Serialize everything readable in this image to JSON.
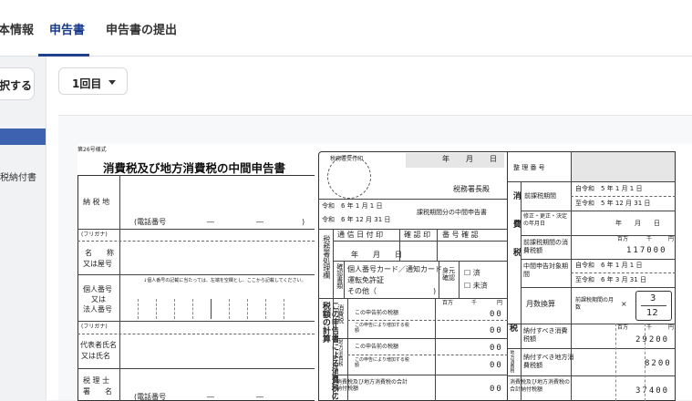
{
  "tabs": [
    {
      "label": "本情報"
    },
    {
      "label": "申告書"
    },
    {
      "label": "申告書の提出"
    }
  ],
  "sidebar": {
    "action_label": "択する",
    "item_label": "税納付書"
  },
  "period_select": {
    "value": "1回目"
  },
  "form": {
    "form_number": "第26号様式",
    "title": "消費税及び地方消費税の中間申告書",
    "stamp_label": "税務署受付印",
    "date_year": "年",
    "date_month": "月",
    "date_day": "日",
    "tax_office_suffix": "税務署長殿",
    "seiri_label": "整 理 番 号",
    "nozeichi_label": "納 税 地",
    "phone_label": "(電話番号",
    "dash": "―",
    "paren_close": ")",
    "furigana": "(フリガナ)",
    "name_label": [
      "名　　称",
      "又は屋号"
    ],
    "mynumber_note": "↓個人番号の記載に当たっては、左端を空欄とし、ここから記載してください。",
    "mynumber_label": [
      "個人番号",
      "又は",
      "法人番号"
    ],
    "rep_label": [
      "代表者氏名",
      "又は氏名"
    ],
    "zeirishi_label": [
      "税 理 士",
      "署　　名"
    ],
    "period_from": "令和　6 年 1 月 1 日",
    "period_to": "令和　6 年 12 月 31 日",
    "period_caption": "課税期間分の中間申告書",
    "shori_label": "税務署処理欄",
    "tsushin_label": "通 信 日 付 印",
    "kakunin_label": "確 認 印",
    "bango_label": "番 号 確 認",
    "date_cell": "年　　月　　日",
    "kakunin_shorui": "確認書類",
    "id_docs": [
      "個人番号カード／通知カード",
      "運転免許証",
      "その他（"
    ],
    "mimoto": "身元確認",
    "check_done": "☐ 済",
    "check_not": "☐ 未済",
    "unit_hyakuman": "百万",
    "unit_sen": "千",
    "unit_en": "円",
    "shinkoku_side": "この申告書による消費税の税額の計算",
    "rows": [
      {
        "label": "この申告前の税額",
        "value": "00"
      },
      {
        "label": "この申告により増加する税額",
        "value": "00"
      },
      {
        "label": "この申告前の税額",
        "value": "00"
      },
      {
        "label": "この申告により増加する税額",
        "value": "00"
      },
      {
        "label": "消費税及び地方消費税の合計納付税額",
        "value": "00"
      }
    ],
    "cat_shohi": "消費税",
    "cat_chiho": "地方消費税",
    "kaku": "修正の",
    "right_side": "消費税",
    "zenkazei": "前課税期間",
    "from_prev": "自令和　5 年 1 月 1 日",
    "to_prev": "至令和　5 年 12 月 31 日",
    "shusei": "修正・更正・決定の年月日",
    "shusei_date": "年　　月　　日",
    "prev_tax_label": "前課税期間の消費税額",
    "prev_tax_value": "117000",
    "chukan_label": "中間申告対象期間",
    "chukan_from": "自令和　6 年 1 月 1 日",
    "chukan_to": "至令和　6 年 3 月 31 日",
    "gessu_label": "月数換算",
    "gessu_formula": "前課税期間の月数",
    "times": "×",
    "frac_num": "3",
    "frac_den": "12",
    "nofu_shohi_label": "納付すべき消費税額",
    "nofu_shohi_value": "29200",
    "nofu_chiho_label": "納付すべき地方消費税額",
    "nofu_chiho_value": "8200",
    "total_label": "消費税及び地方消費税の合計納付税額",
    "total_value": "37400",
    "zei_mark": "税",
    "chiho_mark": "地方消費税"
  }
}
